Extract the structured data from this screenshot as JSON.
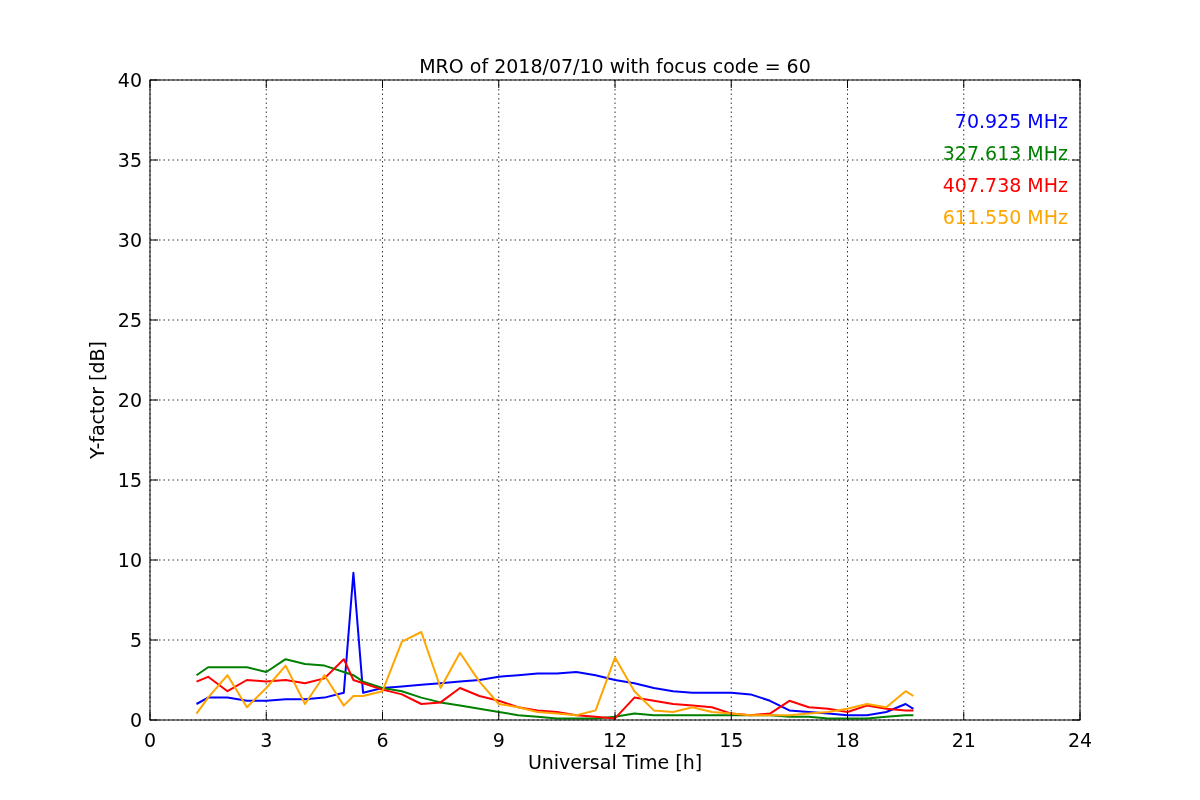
{
  "chart_data": {
    "type": "line",
    "title": "MRO of 2018/07/10 with focus code = 60",
    "xlabel": "Universal Time [h]",
    "ylabel": "Y-factor [dB]",
    "x": [
      1.2,
      1.5,
      2,
      2.5,
      3,
      3.5,
      4,
      4.5,
      5,
      5.25,
      5.5,
      6,
      6.5,
      7,
      7.5,
      8,
      8.5,
      9,
      9.5,
      10,
      10.5,
      11,
      11.5,
      12,
      12.5,
      13,
      13.5,
      14,
      14.5,
      15,
      15.5,
      16,
      16.5,
      17,
      17.5,
      18,
      18.5,
      19,
      19.5,
      19.7
    ],
    "series": [
      {
        "name": "70.925 MHz",
        "color": "#0000ff",
        "values": [
          1.0,
          1.4,
          1.4,
          1.2,
          1.2,
          1.3,
          1.3,
          1.4,
          1.7,
          9.2,
          1.7,
          2.0,
          2.1,
          2.2,
          2.3,
          2.4,
          2.5,
          2.7,
          2.8,
          2.9,
          2.9,
          3.0,
          2.8,
          2.5,
          2.3,
          2.0,
          1.8,
          1.7,
          1.7,
          1.7,
          1.6,
          1.2,
          0.6,
          0.5,
          0.4,
          0.3,
          0.3,
          0.5,
          1.0,
          0.7
        ]
      },
      {
        "name": "327.613 MHz",
        "color": "#008000",
        "values": [
          2.8,
          3.3,
          3.3,
          3.3,
          3.0,
          3.8,
          3.5,
          3.4,
          3.0,
          2.8,
          2.4,
          2.0,
          1.8,
          1.4,
          1.1,
          0.9,
          0.7,
          0.5,
          0.3,
          0.2,
          0.1,
          0.1,
          0.1,
          0.2,
          0.4,
          0.3,
          0.3,
          0.3,
          0.3,
          0.3,
          0.3,
          0.3,
          0.2,
          0.2,
          0.1,
          0.1,
          0.1,
          0.2,
          0.3,
          0.3
        ]
      },
      {
        "name": "407.738 MHz",
        "color": "#ff0000",
        "values": [
          2.4,
          2.7,
          1.8,
          2.5,
          2.4,
          2.5,
          2.3,
          2.6,
          3.8,
          2.5,
          2.3,
          1.9,
          1.6,
          1.0,
          1.1,
          2.0,
          1.5,
          1.2,
          0.8,
          0.6,
          0.5,
          0.3,
          0.2,
          0.1,
          1.4,
          1.2,
          1.0,
          0.9,
          0.8,
          0.4,
          0.3,
          0.4,
          1.2,
          0.8,
          0.7,
          0.5,
          0.9,
          0.7,
          0.6,
          0.6
        ]
      },
      {
        "name": "611.550 MHz",
        "color": "#ffa500",
        "values": [
          0.4,
          1.4,
          2.8,
          0.8,
          2.0,
          3.4,
          1.0,
          2.8,
          0.9,
          1.5,
          1.5,
          1.8,
          4.9,
          5.5,
          2.0,
          4.2,
          2.4,
          1.0,
          0.8,
          0.5,
          0.4,
          0.3,
          0.6,
          3.9,
          1.8,
          0.6,
          0.5,
          0.8,
          0.5,
          0.4,
          0.3,
          0.3,
          0.3,
          0.4,
          0.5,
          0.7,
          1.0,
          0.8,
          1.8,
          1.5
        ]
      }
    ],
    "grid": true,
    "xlim": [
      0,
      24
    ],
    "ylim": [
      0,
      40
    ],
    "xticks": [
      0,
      3,
      6,
      9,
      12,
      15,
      18,
      21,
      24
    ],
    "yticks": [
      0,
      5,
      10,
      15,
      20,
      25,
      30,
      35,
      40
    ]
  }
}
